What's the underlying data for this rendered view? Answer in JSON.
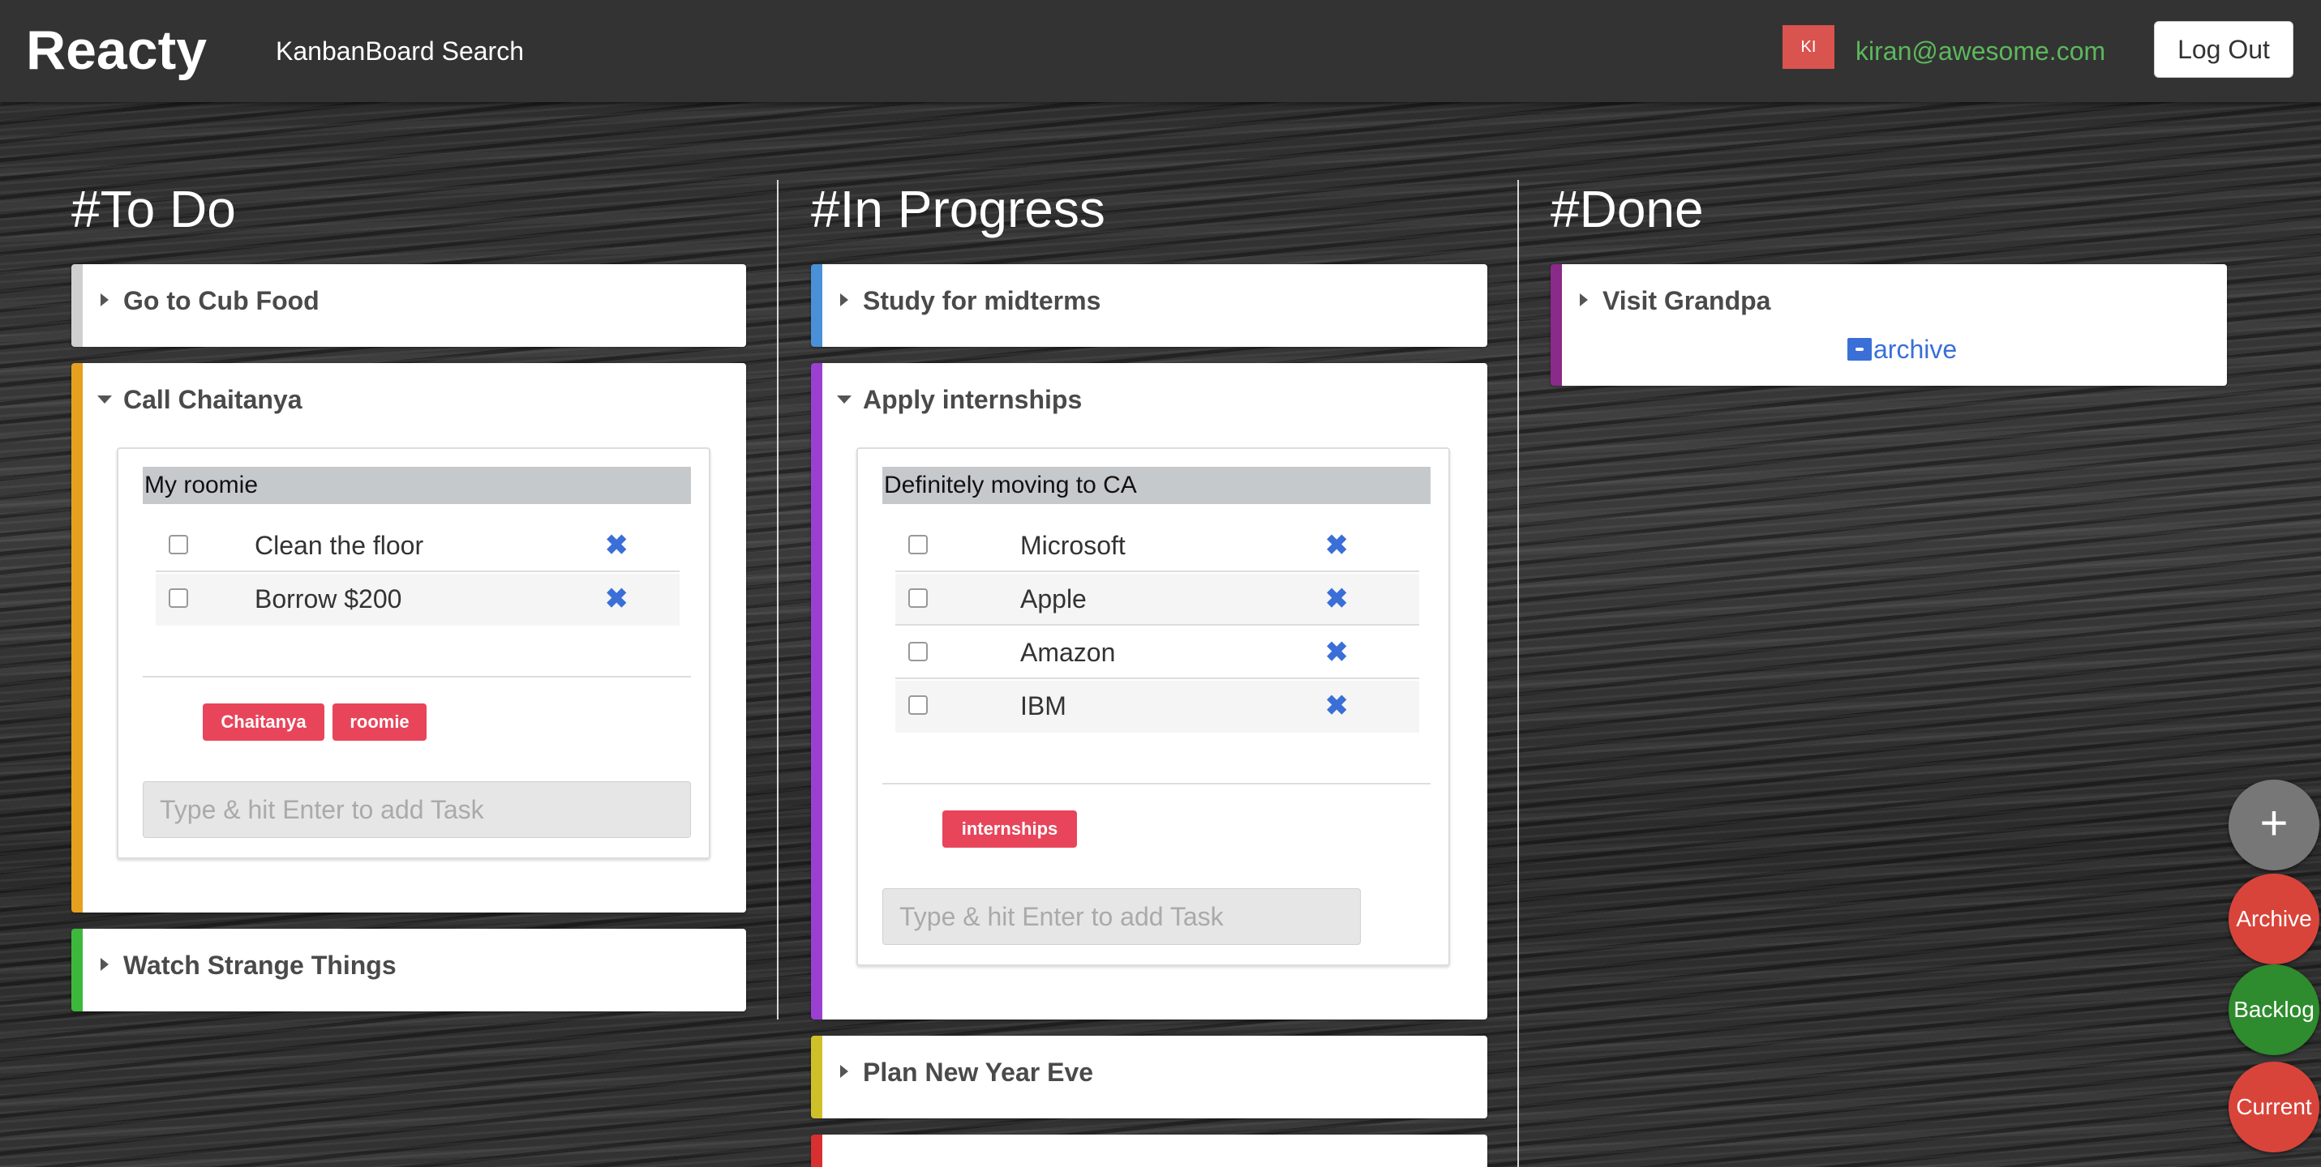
{
  "navbar": {
    "brand": "Reacty",
    "link": "KanbanBoard Search",
    "avatar": "KI",
    "user_email": "kiran@awesome.com",
    "logout": "Log Out"
  },
  "columns": [
    {
      "title": "#To Do"
    },
    {
      "title": "#In Progress"
    },
    {
      "title": "#Done"
    }
  ],
  "todo": {
    "card1": {
      "title": "Go to Cub Food",
      "color": "#cfcfcf"
    },
    "card2": {
      "title": "Call Chaitanya",
      "color": "#e6a020",
      "list_title": "My roomie",
      "tasks": [
        "Clean the floor",
        "Borrow $200"
      ],
      "tags": [
        "Chaitanya",
        "roomie"
      ],
      "input_placeholder": "Type & hit Enter to add Task"
    },
    "card3": {
      "title": "Watch Strange Things",
      "color": "#3cb93c"
    }
  },
  "inprogress": {
    "card1": {
      "title": "Study for midterms",
      "color": "#4a90d9"
    },
    "card2": {
      "title": "Apply internships",
      "color": "#9b3fd0",
      "list_title": "Definitely moving to CA",
      "tasks": [
        "Microsoft",
        "Apple",
        "Amazon",
        "IBM"
      ],
      "tags": [
        "internships"
      ],
      "input_placeholder": "Type & hit Enter to add Task"
    },
    "card3": {
      "title": "Plan New Year Eve",
      "color": "#cfc02a"
    },
    "card4": {
      "color": "#d83030"
    }
  },
  "done": {
    "card1": {
      "title": "Visit Grandpa",
      "color": "#8a2a8a",
      "archive_label": "archive"
    }
  },
  "icons": {
    "delete": "✖",
    "add": "+"
  },
  "fabs": {
    "archive": {
      "label": "Archive",
      "color": "#d9443a"
    },
    "backlog": {
      "label": "Backlog",
      "color": "#2e8b2e"
    },
    "current": {
      "label": "Current",
      "color": "#d9443a"
    }
  }
}
